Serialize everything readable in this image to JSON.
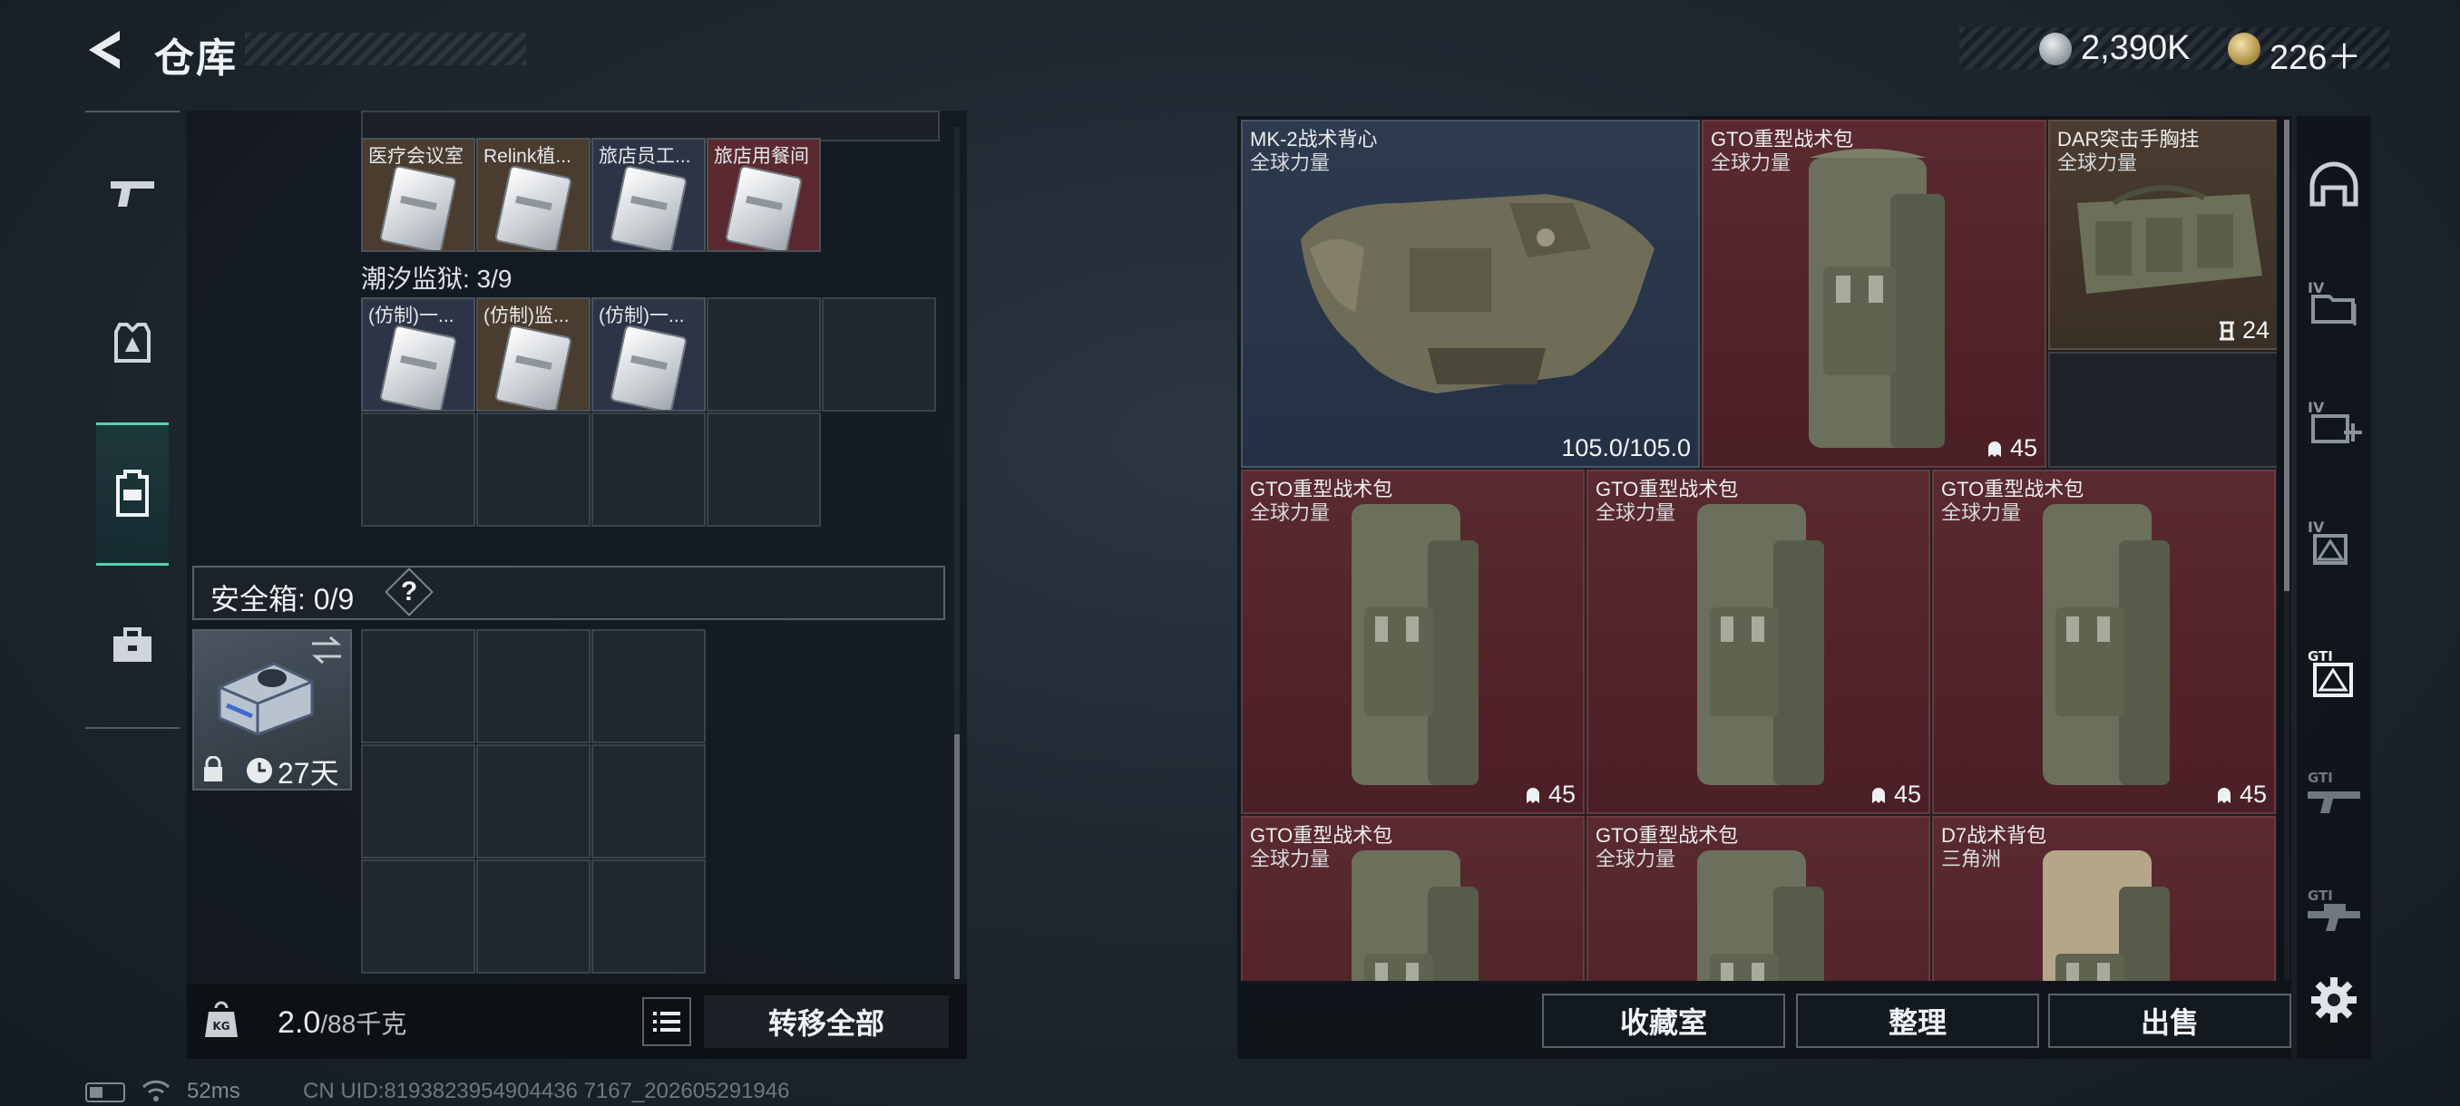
{
  "header": {
    "title": "仓库"
  },
  "currency": {
    "silver": "2,390K",
    "gold": "226＋"
  },
  "left_nav": [
    "gun-icon",
    "armor-icon",
    "backpack-icon",
    "toolbox-icon"
  ],
  "upper_items": [
    {
      "label": "医疗会议室",
      "tint": "#4a3c2e"
    },
    {
      "label": "Relink植...",
      "tint": "#4a3c2e"
    },
    {
      "label": "旅店员工...",
      "tint": "#2e3448"
    },
    {
      "label": "旅店用餐间",
      "tint": "#5a2a30"
    }
  ],
  "section_prison": {
    "title": "潮汐监狱: 3/9",
    "items": [
      {
        "label": "(仿制)一...",
        "tint": "#2e3448"
      },
      {
        "label": "(仿制)监...",
        "tint": "#4a3c2e"
      },
      {
        "label": "(仿制)一...",
        "tint": "#2e3448"
      }
    ]
  },
  "safe_box": {
    "label": "安全箱: 0/9",
    "help": "?",
    "days": "27天"
  },
  "weight": {
    "current": "2.0",
    "max": "/88千克"
  },
  "buttons": {
    "transfer_all": "转移全部",
    "collection": "收藏室",
    "organize": "整理",
    "sell": "出售"
  },
  "inventory": [
    {
      "name": "MK-2战术背心",
      "sub": "全球力量",
      "count": "105.0/105.0",
      "count_icon": ""
    },
    {
      "name": "GTO重型战术包",
      "sub": "全球力量",
      "count": "45",
      "count_icon": "ghost-icon"
    },
    {
      "name": "DAR突击手胸挂",
      "sub": "全球力量",
      "count": "24",
      "count_icon": "slot-icon"
    },
    {
      "name": "GTO重型战术包",
      "sub": "全球力量",
      "count": "45",
      "count_icon": "ghost-icon"
    },
    {
      "name": "GTO重型战术包",
      "sub": "全球力量",
      "count": "45",
      "count_icon": "ghost-icon"
    },
    {
      "name": "GTO重型战术包",
      "sub": "全球力量",
      "count": "45",
      "count_icon": "ghost-icon"
    },
    {
      "name": "GTO重型战术包",
      "sub": "全球力量",
      "count": "",
      "count_icon": ""
    },
    {
      "name": "GTO重型战术包",
      "sub": "全球力量",
      "count": "",
      "count_icon": ""
    },
    {
      "name": "D7战术背包",
      "sub": "三角洲",
      "count": "",
      "count_icon": ""
    }
  ],
  "right_nav": [
    "helmet-icon",
    "iv-folder-icon",
    "iv-medkit-icon",
    "iv-triangle-icon",
    "gti-box-icon",
    "gti-gun-icon",
    "gti-rifle-icon"
  ],
  "status": {
    "ping": "52ms",
    "uid": "CN UID:8193823954904436 7167_202605291946"
  },
  "colors": {
    "accent": "#57d0b0",
    "rarity_red": "#5a2a30",
    "rarity_blue": "#2e3a4e",
    "rarity_gold": "#4a3c30"
  }
}
